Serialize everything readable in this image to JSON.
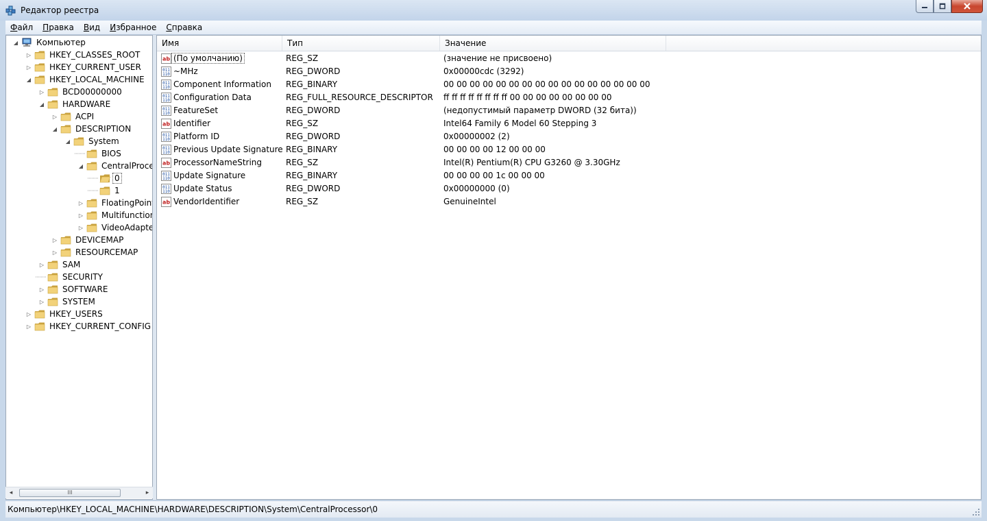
{
  "window": {
    "title": "Редактор реестра"
  },
  "menu": [
    {
      "key": "Ф",
      "rest": "айл"
    },
    {
      "key": "П",
      "rest": "равка"
    },
    {
      "key": "В",
      "rest": "ид"
    },
    {
      "key": "И",
      "rest": "збранное"
    },
    {
      "key": "С",
      "rest": "правка"
    }
  ],
  "tree": [
    {
      "label": "Компьютер",
      "depth": 0,
      "expander": "expanded",
      "icon": "computer"
    },
    {
      "label": "HKEY_CLASSES_ROOT",
      "depth": 1,
      "expander": "collapsed",
      "icon": "folder"
    },
    {
      "label": "HKEY_CURRENT_USER",
      "depth": 1,
      "expander": "collapsed",
      "icon": "folder"
    },
    {
      "label": "HKEY_LOCAL_MACHINE",
      "depth": 1,
      "expander": "expanded",
      "icon": "folder"
    },
    {
      "label": "BCD00000000",
      "depth": 2,
      "expander": "collapsed",
      "icon": "folder"
    },
    {
      "label": "HARDWARE",
      "depth": 2,
      "expander": "expanded",
      "icon": "folder"
    },
    {
      "label": "ACPI",
      "depth": 3,
      "expander": "collapsed",
      "icon": "folder"
    },
    {
      "label": "DESCRIPTION",
      "depth": 3,
      "expander": "expanded",
      "icon": "folder"
    },
    {
      "label": "System",
      "depth": 4,
      "expander": "expanded",
      "icon": "folder"
    },
    {
      "label": "BIOS",
      "depth": 5,
      "expander": "none",
      "icon": "folder"
    },
    {
      "label": "CentralProces",
      "depth": 5,
      "expander": "expanded",
      "icon": "folder"
    },
    {
      "label": "0",
      "depth": 6,
      "expander": "none",
      "icon": "folder-open",
      "selected": true
    },
    {
      "label": "1",
      "depth": 6,
      "expander": "none",
      "icon": "folder"
    },
    {
      "label": "FloatingPointP",
      "depth": 5,
      "expander": "collapsed",
      "icon": "folder"
    },
    {
      "label": "Multifunction.",
      "depth": 5,
      "expander": "collapsed",
      "icon": "folder"
    },
    {
      "label": "VideoAdapterl",
      "depth": 5,
      "expander": "collapsed",
      "icon": "folder"
    },
    {
      "label": "DEVICEMAP",
      "depth": 3,
      "expander": "collapsed",
      "icon": "folder"
    },
    {
      "label": "RESOURCEMAP",
      "depth": 3,
      "expander": "collapsed",
      "icon": "folder"
    },
    {
      "label": "SAM",
      "depth": 2,
      "expander": "collapsed",
      "icon": "folder"
    },
    {
      "label": "SECURITY",
      "depth": 2,
      "expander": "none",
      "icon": "folder"
    },
    {
      "label": "SOFTWARE",
      "depth": 2,
      "expander": "collapsed",
      "icon": "folder"
    },
    {
      "label": "SYSTEM",
      "depth": 2,
      "expander": "collapsed",
      "icon": "folder"
    },
    {
      "label": "HKEY_USERS",
      "depth": 1,
      "expander": "collapsed",
      "icon": "folder"
    },
    {
      "label": "HKEY_CURRENT_CONFIG",
      "depth": 1,
      "expander": "collapsed",
      "icon": "folder"
    }
  ],
  "columns": {
    "name": "Имя",
    "type": "Тип",
    "value": "Значение"
  },
  "values": [
    {
      "icon": "ab",
      "name": "(По умолчанию)",
      "type": "REG_SZ",
      "value": "(значение не присвоено)",
      "focused": true
    },
    {
      "icon": "bin",
      "name": "~MHz",
      "type": "REG_DWORD",
      "value": "0x00000cdc (3292)"
    },
    {
      "icon": "bin",
      "name": "Component Information",
      "type": "REG_BINARY",
      "value": "00 00 00 00 00 00 00 00 00 00 00 00 00 00 00 00"
    },
    {
      "icon": "bin",
      "name": "Configuration Data",
      "type": "REG_FULL_RESOURCE_DESCRIPTOR",
      "value": "ff ff ff ff ff ff ff ff 00 00 00 00 00 00 00 00"
    },
    {
      "icon": "bin",
      "name": "FeatureSet",
      "type": "REG_DWORD",
      "value": "(недопустимый параметр DWORD (32 бита))"
    },
    {
      "icon": "ab",
      "name": "Identifier",
      "type": "REG_SZ",
      "value": "Intel64 Family 6 Model 60 Stepping 3"
    },
    {
      "icon": "bin",
      "name": "Platform ID",
      "type": "REG_DWORD",
      "value": "0x00000002 (2)"
    },
    {
      "icon": "bin",
      "name": "Previous Update Signature",
      "type": "REG_BINARY",
      "value": "00 00 00 00 12 00 00 00"
    },
    {
      "icon": "ab",
      "name": "ProcessorNameString",
      "type": "REG_SZ",
      "value": "Intel(R) Pentium(R) CPU G3260 @ 3.30GHz"
    },
    {
      "icon": "bin",
      "name": "Update Signature",
      "type": "REG_BINARY",
      "value": "00 00 00 00 1c 00 00 00"
    },
    {
      "icon": "bin",
      "name": "Update Status",
      "type": "REG_DWORD",
      "value": "0x00000000 (0)"
    },
    {
      "icon": "ab",
      "name": "VendorIdentifier",
      "type": "REG_SZ",
      "value": "GenuineIntel"
    }
  ],
  "status": {
    "path": "Компьютер\\HKEY_LOCAL_MACHINE\\HARDWARE\\DESCRIPTION\\System\\CentralProcessor\\0"
  },
  "scroll": {
    "thumb_glyph": "III"
  },
  "colors": {
    "folder": "#f2d27a",
    "folder_dark": "#c9a23e",
    "selection_outline": "#555555",
    "title_gradient_top": "#dbe6f3"
  }
}
